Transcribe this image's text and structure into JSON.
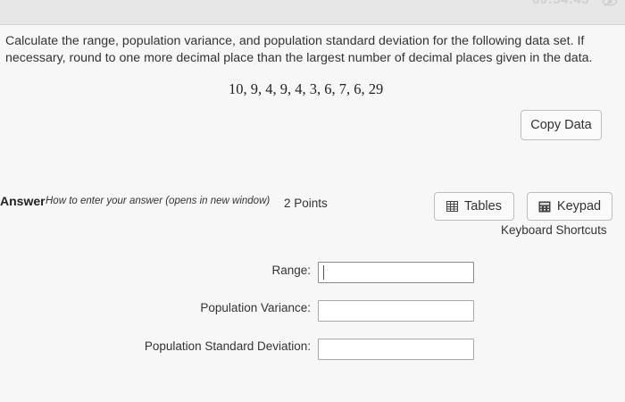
{
  "header": {
    "timer": "00:54:45",
    "eye_icon": "eye-slash-icon"
  },
  "question": {
    "text": "Calculate the range, population variance, and population standard deviation for the following data set. If necessary, round to one more decimal place than the largest number of decimal places given in the data.",
    "dataset": "10, 9, 4, 9, 4, 3, 6, 7, 6, 29",
    "copy_data_label": "Copy Data"
  },
  "answer": {
    "label": "Answer",
    "howto_link": "How to enter your answer (opens in new window)",
    "points": "2 Points",
    "tables_label": "Tables",
    "tables_icon": "table-grid-icon",
    "keypad_label": "Keypad",
    "keypad_icon": "keypad-icon",
    "shortcuts_link": "Keyboard Shortcuts",
    "fields": {
      "range_label": "Range:",
      "range_value": "",
      "variance_label": "Population Variance:",
      "variance_value": "",
      "sd_label": "Population Standard Deviation:",
      "sd_value": ""
    }
  },
  "colors": {
    "page_bg": "#e6e6e6",
    "panel_bg": "#f7f7f7",
    "button_bg": "#fafafa",
    "border": "#bdbdbd"
  }
}
